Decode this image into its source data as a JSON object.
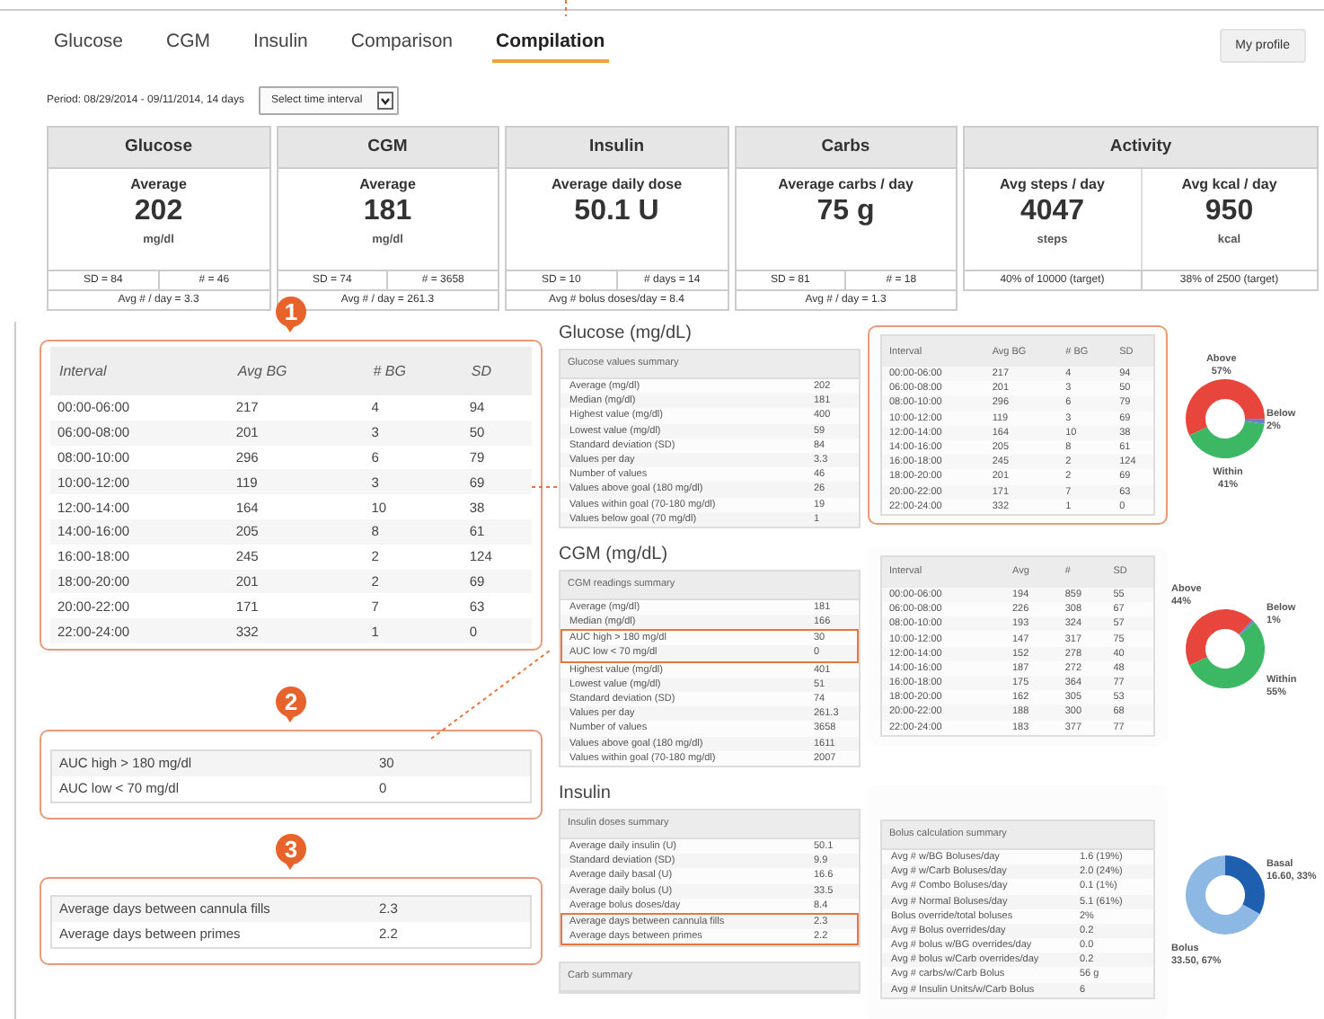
{
  "tabs": [
    {
      "label": "Glucose",
      "selected": false
    },
    {
      "label": "CGM",
      "selected": false
    },
    {
      "label": "Insulin",
      "selected": false
    },
    {
      "label": "Comparison",
      "selected": false
    },
    {
      "label": "Compilation",
      "selected": true
    }
  ],
  "profile_button": "My profile",
  "period": {
    "label": "Period: 08/29/2014 - 09/11/2014, 14 days",
    "select": "Select time interval"
  },
  "summary_cards": [
    {
      "title": "Glucose",
      "metrics": [
        {
          "label": "Average",
          "value": "202",
          "unit": "mg/dl"
        }
      ],
      "stats": [
        "SD = 84",
        "# = 46"
      ],
      "footer": "Avg # / day = 3.3"
    },
    {
      "title": "CGM",
      "metrics": [
        {
          "label": "Average",
          "value": "181",
          "unit": "mg/dl"
        }
      ],
      "stats": [
        "SD = 74",
        "# = 3658"
      ],
      "footer": "Avg # / day = 261.3"
    },
    {
      "title": "Insulin",
      "metrics": [
        {
          "label": "Average daily dose",
          "value": "50.1 U"
        }
      ],
      "stats": [
        "SD = 10",
        "# days = 14"
      ],
      "footer": "Avg # bolus doses/day = 8.4"
    },
    {
      "title": "Carbs",
      "metrics": [
        {
          "label": "Average carbs / day",
          "value": "75 g"
        }
      ],
      "stats": [
        "SD = 81",
        "# = 18"
      ],
      "footer": "Avg # / day = 1.3"
    },
    {
      "title": "Activity",
      "metrics": [
        {
          "label": "Avg steps / day",
          "value": "4047",
          "unit": "steps"
        },
        {
          "label": "Avg kcal / day",
          "value": "950",
          "unit": "kcal"
        }
      ],
      "stats": [
        "40% of 10000 (target)",
        "38% of 2500 (target)"
      ]
    }
  ],
  "callouts": [
    {
      "number": "1",
      "kind": "intervals",
      "columns": [
        "Interval",
        "Avg BG",
        "# BG",
        "SD"
      ],
      "rows": [
        [
          "00:00-06:00",
          "217",
          "4",
          "94"
        ],
        [
          "06:00-08:00",
          "201",
          "3",
          "50"
        ],
        [
          "08:00-10:00",
          "296",
          "6",
          "79"
        ],
        [
          "10:00-12:00",
          "119",
          "3",
          "69"
        ],
        [
          "12:00-14:00",
          "164",
          "10",
          "38"
        ],
        [
          "14:00-16:00",
          "205",
          "8",
          "61"
        ],
        [
          "16:00-18:00",
          "245",
          "2",
          "124"
        ],
        [
          "18:00-20:00",
          "201",
          "2",
          "69"
        ],
        [
          "20:00-22:00",
          "171",
          "7",
          "63"
        ],
        [
          "22:00-24:00",
          "332",
          "1",
          "0"
        ]
      ]
    },
    {
      "number": "2",
      "kind": "pairs",
      "rows": [
        [
          "AUC high > 180 mg/dl",
          "30"
        ],
        [
          "AUC low < 70 mg/dl",
          "0"
        ]
      ]
    },
    {
      "number": "3",
      "kind": "pairs",
      "rows": [
        [
          "Average days between cannula fills",
          "2.3"
        ],
        [
          "Average days between primes",
          "2.2"
        ]
      ]
    }
  ],
  "sections": [
    {
      "heading": "Glucose (mg/dL)",
      "tables": [
        {
          "title": "Glucose values summary",
          "rows": [
            {
              "label": "Average (mg/dl)",
              "value": "202",
              "highlighted": false
            },
            {
              "label": "Median (mg/dl)",
              "value": "181",
              "highlighted": false
            },
            {
              "label": "Highest value (mg/dl)",
              "value": "400",
              "highlighted": false
            },
            {
              "label": "Lowest value (mg/dl)",
              "value": "59",
              "highlighted": false
            },
            {
              "label": "Standard deviation (SD)",
              "value": "84",
              "highlighted": false
            },
            {
              "label": "Values per day",
              "value": "3.3",
              "highlighted": false
            },
            {
              "label": "Number of values",
              "value": "46",
              "highlighted": false
            },
            {
              "label": "Values above goal (180 mg/dl)",
              "value": "26",
              "highlighted": false
            },
            {
              "label": "Values within goal (70-180 mg/dl)",
              "value": "19",
              "highlighted": false
            },
            {
              "label": "Values below goal (70 mg/dl)",
              "value": "1",
              "highlighted": false
            }
          ]
        }
      ],
      "side_table": {
        "kind": "intervals",
        "highlighted": true,
        "columns": [
          "Interval",
          "Avg BG",
          "# BG",
          "SD"
        ],
        "rows": [
          [
            "00:00-06:00",
            "217",
            "4",
            "94"
          ],
          [
            "06:00-08:00",
            "201",
            "3",
            "50"
          ],
          [
            "08:00-10:00",
            "296",
            "6",
            "79"
          ],
          [
            "10:00-12:00",
            "119",
            "3",
            "69"
          ],
          [
            "12:00-14:00",
            "164",
            "10",
            "38"
          ],
          [
            "14:00-16:00",
            "205",
            "8",
            "61"
          ],
          [
            "16:00-18:00",
            "245",
            "2",
            "124"
          ],
          [
            "18:00-20:00",
            "201",
            "2",
            "69"
          ],
          [
            "20:00-22:00",
            "171",
            "7",
            "63"
          ],
          [
            "22:00-24:00",
            "332",
            "1",
            "0"
          ]
        ]
      },
      "chart_data": {
        "type": "donut",
        "categories": [
          "Above",
          "Below",
          "Within"
        ],
        "values": [
          57,
          2,
          41
        ],
        "value_labels": [
          "57%",
          "2%",
          "41%"
        ],
        "colors": [
          "#e8453c",
          "#6b7fd0",
          "#3cb865"
        ]
      }
    },
    {
      "heading": "CGM (mg/dL)",
      "tables": [
        {
          "title": "CGM readings summary",
          "rows": [
            {
              "label": "Average (mg/dl)",
              "value": "181",
              "highlighted": false
            },
            {
              "label": "Median (mg/dl)",
              "value": "166",
              "highlighted": false
            },
            {
              "label": "AUC high > 180 mg/dl",
              "value": "30",
              "highlighted": true
            },
            {
              "label": "AUC low < 70 mg/dl",
              "value": "0",
              "highlighted": true
            },
            {
              "label": "Highest value (mg/dl)",
              "value": "401",
              "highlighted": false
            },
            {
              "label": "Lowest value (mg/dl)",
              "value": "51",
              "highlighted": false
            },
            {
              "label": "Standard deviation (SD)",
              "value": "74",
              "highlighted": false
            },
            {
              "label": "Values per day",
              "value": "261.3",
              "highlighted": false
            },
            {
              "label": "Number of values",
              "value": "3658",
              "highlighted": false
            },
            {
              "label": "Values above goal (180 mg/dl)",
              "value": "1611",
              "highlighted": false
            },
            {
              "label": "Values within goal (70-180 mg/dl)",
              "value": "2007",
              "highlighted": false
            }
          ]
        }
      ],
      "side_table": {
        "kind": "intervals",
        "highlighted": false,
        "columns": [
          "Interval",
          "Avg",
          "#",
          "SD"
        ],
        "rows": [
          [
            "00:00-06:00",
            "194",
            "859",
            "55"
          ],
          [
            "06:00-08:00",
            "226",
            "308",
            "67"
          ],
          [
            "08:00-10:00",
            "193",
            "324",
            "57"
          ],
          [
            "10:00-12:00",
            "147",
            "317",
            "75"
          ],
          [
            "12:00-14:00",
            "152",
            "278",
            "40"
          ],
          [
            "14:00-16:00",
            "187",
            "272",
            "48"
          ],
          [
            "16:00-18:00",
            "175",
            "364",
            "77"
          ],
          [
            "18:00-20:00",
            "162",
            "305",
            "53"
          ],
          [
            "20:00-22:00",
            "188",
            "300",
            "68"
          ],
          [
            "22:00-24:00",
            "183",
            "377",
            "77"
          ]
        ]
      },
      "chart_data": {
        "type": "donut",
        "categories": [
          "Above",
          "Below",
          "Within"
        ],
        "values": [
          44,
          1,
          55
        ],
        "value_labels": [
          "44%",
          "1%",
          "55%"
        ],
        "colors": [
          "#e8453c",
          "#6b7fd0",
          "#3cb865"
        ]
      }
    },
    {
      "heading": "Insulin",
      "tables": [
        {
          "title": "Insulin doses summary",
          "rows": [
            {
              "label": "Average daily insulin (U)",
              "value": "50.1",
              "highlighted": false
            },
            {
              "label": "Standard deviation (SD)",
              "value": "9.9",
              "highlighted": false
            },
            {
              "label": "Average daily basal (U)",
              "value": "16.6",
              "highlighted": false
            },
            {
              "label": "Average daily bolus (U)",
              "value": "33.5",
              "highlighted": false
            },
            {
              "label": "Average bolus doses/day",
              "value": "8.4",
              "highlighted": false
            },
            {
              "label": "Average days between cannula fills",
              "value": "2.3",
              "highlighted": true
            },
            {
              "label": "Average days between primes",
              "value": "2.2",
              "highlighted": true
            }
          ]
        },
        {
          "title": "Carb summary"
        }
      ],
      "side_table": {
        "kind": "summary",
        "highlighted": false,
        "title": "Bolus calculation summary",
        "rows": [
          [
            "Avg # w/BG Boluses/day",
            "1.6 (19%)"
          ],
          [
            "Avg # w/Carb Boluses/day",
            "2.0 (24%)"
          ],
          [
            "Avg # Combo Boluses/day",
            "0.1 (1%)"
          ],
          [
            "Avg # Normal Boluses/day",
            "5.1 (61%)"
          ],
          [
            "Bolus override/total boluses",
            "2%"
          ],
          [
            "Avg # Bolus overrides/day",
            "0.2"
          ],
          [
            "Avg # bolus w/BG overrides/day",
            "0.0"
          ],
          [
            "Avg # bolus w/Carb overrides/day",
            "0.2"
          ],
          [
            "Avg # carbs/w/Carb Bolus",
            "56 g"
          ],
          [
            "Avg # Insulin Units/w/Carb Bolus",
            "6"
          ]
        ]
      },
      "chart_data": {
        "type": "donut",
        "categories": [
          "Basal",
          "Bolus"
        ],
        "values": [
          33,
          67
        ],
        "value_labels": [
          "16.60, 33%",
          "33.50, 67%"
        ],
        "colors": [
          "#1f5fb0",
          "#8db8e3"
        ]
      }
    }
  ]
}
